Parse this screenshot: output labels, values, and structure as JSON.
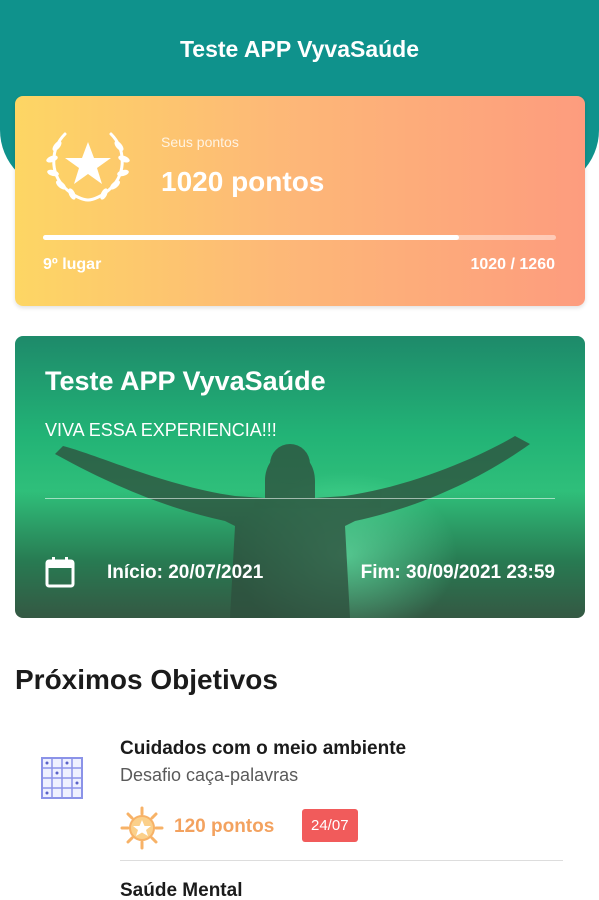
{
  "header": {
    "title": "Teste APP VyvaSaúde"
  },
  "points_card": {
    "label": "Seus pontos",
    "points": "1020 pontos",
    "rank": "9º lugar",
    "progress_text": "1020 / 1260",
    "progress_fraction": 0.81
  },
  "challenge": {
    "title": "Teste APP VyvaSaúde",
    "subtitle": "VIVA ESSA EXPERIENCIA!!!",
    "start": "Início: 20/07/2021",
    "end": "Fim: 30/09/2021 23:59"
  },
  "objectives_section": {
    "title": "Próximos Objetivos",
    "items": [
      {
        "title": "Cuidados com o meio ambiente",
        "subtitle": "Desafio caça-palavras",
        "points": "120 pontos",
        "badge": "24/07",
        "icon": "word-search-grid-icon"
      },
      {
        "title": "Saúde Mental"
      }
    ]
  },
  "colors": {
    "header": "#0f928c",
    "points_gradient_start": "#fdd664",
    "points_gradient_end": "#fd9c7e",
    "badge": "#f15b5b",
    "points_accent": "#f3a25f"
  }
}
